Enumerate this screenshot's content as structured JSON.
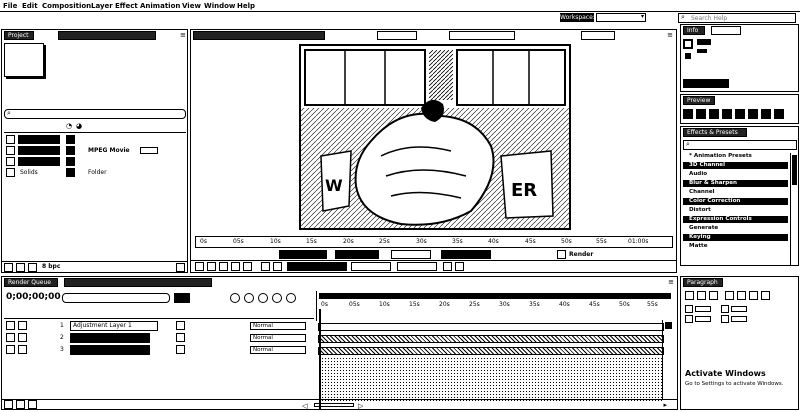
{
  "menu": [
    "File",
    "Edit",
    "Composition",
    "Layer",
    "Effect",
    "Animation",
    "View",
    "Window",
    "Help"
  ],
  "workspace": {
    "label": "Workspace:",
    "value": ""
  },
  "search_help": {
    "placeholder": "Search Help"
  },
  "project_panel": {
    "tab": "Project",
    "search_placeholder": "",
    "items": [
      {
        "name": "",
        "type": ""
      },
      {
        "name": "",
        "type": "MPEG Movie"
      },
      {
        "name": "",
        "type": ""
      },
      {
        "name": "Solids",
        "type": "Folder"
      }
    ],
    "bpc": "8 bpc"
  },
  "viewer": {
    "tab": "",
    "ruler_labels": [
      "0s",
      "05s",
      "10s",
      "15s",
      "20s",
      "25s",
      "30s",
      "35s",
      "40s",
      "45s",
      "50s",
      "55s",
      "01:00s"
    ],
    "buttons": [
      "",
      "",
      "",
      "",
      ""
    ],
    "render_label": "Render"
  },
  "info_panel": {
    "tab": "Info"
  },
  "preview_panel": {
    "tab": "Preview"
  },
  "effects_panel": {
    "tab": "Effects & Presets",
    "search_value": "",
    "categories": [
      "* Animation Presets",
      "3D Channel",
      "Audio",
      "Blur & Sharpen",
      "Channel",
      "Color Correction",
      "Distort",
      "Expression Controls",
      "Generate",
      "Keying",
      "Matte"
    ]
  },
  "paragraph_panel": {
    "tab": "Paragraph"
  },
  "timeline": {
    "tab": "Render Queue",
    "comp_tab": "",
    "timecode": "0;00;00;00",
    "layers": [
      {
        "num": "1",
        "name": "Adjustment Layer 1",
        "mode": "Normal"
      },
      {
        "num": "2",
        "name": "",
        "mode": "Normal"
      },
      {
        "num": "3",
        "name": "",
        "mode": "Normal"
      }
    ],
    "ruler_labels": [
      "0s",
      "05s",
      "10s",
      "15s",
      "20s",
      "25s",
      "30s",
      "35s",
      "40s",
      "45s",
      "50s",
      "55s"
    ]
  },
  "watermark": {
    "line1": "Activate Windows",
    "line2": "Go to Settings to activate Windows."
  },
  "colors": {
    "ink": "#000000",
    "paper": "#ffffff",
    "selected": "#222222"
  }
}
